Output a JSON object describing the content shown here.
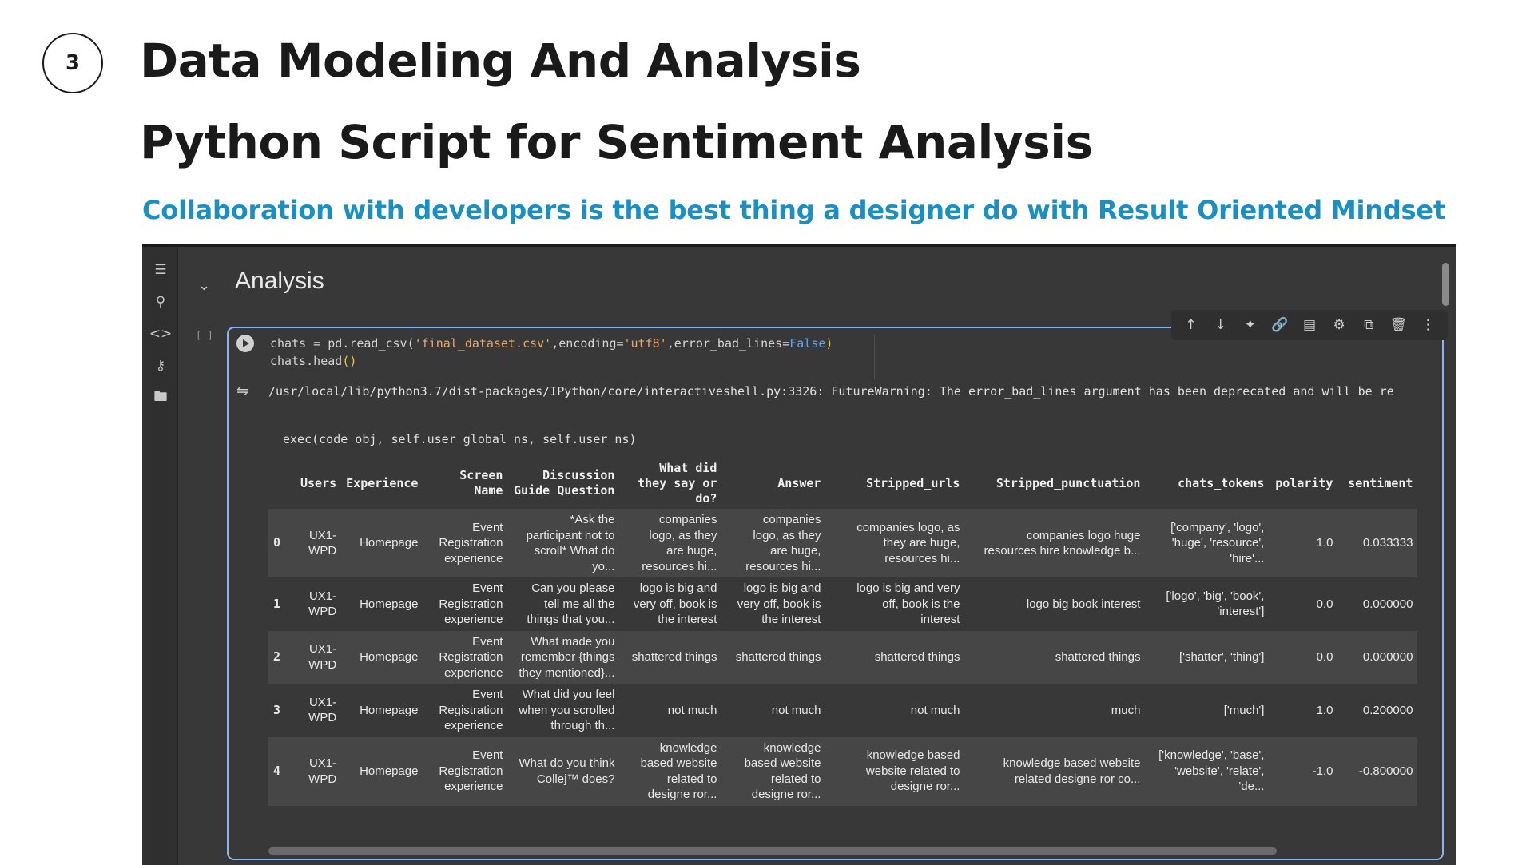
{
  "slide": {
    "step_number": "3",
    "title_line1": "Data Modeling And Analysis",
    "title_line2": "Python Script for Sentiment Analysis",
    "subtitle": "Collaboration with developers is the best thing a designer do with Result Oriented Mindset",
    "colors": {
      "subtitle": "#1a8fc4",
      "title": "#1a1a1a"
    }
  },
  "notebook": {
    "section_title": "Analysis",
    "exec_count": "[ ]",
    "rail_icons": [
      "table-of-contents-icon",
      "find-icon",
      "code-snippets-icon",
      "secrets-key-icon",
      "files-folder-icon"
    ],
    "toolbar_icons": [
      "move-up-icon",
      "move-down-icon",
      "gemini-sparkle-icon",
      "link-icon",
      "comment-icon",
      "settings-gear-icon",
      "mirror-cell-icon",
      "delete-icon",
      "more-options-icon"
    ],
    "code": {
      "line1_a": "chats = pd.read_csv(",
      "line1_str1": "'final_dataset.csv'",
      "line1_b": ",encoding=",
      "line1_str2": "'utf8'",
      "line1_c": ",error_bad_lines=",
      "line1_kw": "False",
      "line1_d": ")",
      "line2_a": "chats.head",
      "line2_paren": "()"
    },
    "output": {
      "warning": "/usr/local/lib/python3.7/dist-packages/IPython/core/interactiveshell.py:3326: FutureWarning: The error_bad_lines argument has been deprecated and will be re",
      "exec_line": "exec(code_obj, self.user_global_ns, self.user_ns)"
    },
    "table": {
      "headers": [
        "",
        "Users",
        "Experience",
        "Screen\nName",
        "Discussion\nGuide Question",
        "What did\nthey say or\ndo?",
        "Answer",
        "Stripped_urls",
        "Stripped_punctuation",
        "chats_tokens",
        "polarity",
        "sentiment"
      ],
      "rows": [
        [
          "0",
          "UX1-\nWPD",
          "Homepage",
          "Event\nRegistration\nexperience",
          "*Ask the\nparticipant not to\nscroll* What do\nyo...",
          "companies\nlogo, as they\nare huge,\nresources hi...",
          "companies\nlogo, as they\nare huge,\nresources hi...",
          "companies logo, as\nthey are huge,\nresources hi...",
          "companies logo huge\nresources hire knowledge b...",
          "['company', 'logo',\n'huge', 'resource',\n'hire'...",
          "1.0",
          "0.033333"
        ],
        [
          "1",
          "UX1-\nWPD",
          "Homepage",
          "Event\nRegistration\nexperience",
          "Can you please\ntell me all the\nthings that you...",
          "logo is big and\nvery off, book is\nthe interest",
          "logo is big and\nvery off, book is\nthe interest",
          "logo is big and very\noff, book is the\ninterest",
          "logo big book interest",
          "['logo', 'big', 'book',\n'interest']",
          "0.0",
          "0.000000"
        ],
        [
          "2",
          "UX1-\nWPD",
          "Homepage",
          "Event\nRegistration\nexperience",
          "What made you\nremember {things\nthey mentioned}...",
          "shattered things",
          "shattered things",
          "shattered things",
          "shattered things",
          "['shatter', 'thing']",
          "0.0",
          "0.000000"
        ],
        [
          "3",
          "UX1-\nWPD",
          "Homepage",
          "Event\nRegistration\nexperience",
          "What did you feel\nwhen you scrolled\nthrough th...",
          "not much",
          "not much",
          "not much",
          "much",
          "['much']",
          "1.0",
          "0.200000"
        ],
        [
          "4",
          "UX1-\nWPD",
          "Homepage",
          "Event\nRegistration\nexperience",
          "What do you think\nCollej™ does?",
          "knowledge\nbased website\nrelated to\ndesigne ror...",
          "knowledge\nbased website\nrelated to\ndesigne ror...",
          "knowledge based\nwebsite related to\ndesigne ror...",
          "knowledge based website\nrelated designe ror co...",
          "['knowledge', 'base',\n'website', 'relate',\n'de...",
          "-1.0",
          "-0.800000"
        ]
      ]
    }
  }
}
